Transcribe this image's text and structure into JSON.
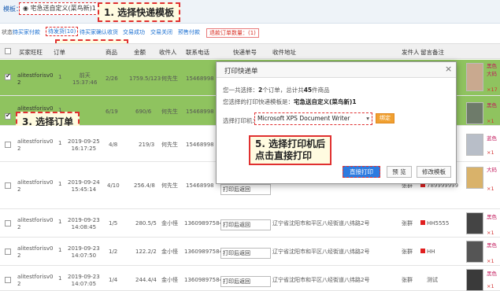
{
  "template_select": {
    "label": "模板：",
    "value": "宅急送自定义(菜鸟新)1"
  },
  "callouts": {
    "c1": "1. 选择快递模板",
    "c2": "2. 点击待发货",
    "c3": "3. 选择订单",
    "c5": "5. 选择打印机后\n点击直接打印"
  },
  "tabs": {
    "label": "状态：",
    "items": [
      "待买家付款",
      "待发货(10)",
      "待买家确认收货",
      "交易成功",
      "交易关闭",
      "预售付款"
    ],
    "refund": "退款订单数量：(1)"
  },
  "table_header": [
    "全选",
    "买家旺旺",
    "订单",
    "商品",
    "金额",
    "收件人",
    "联系电话",
    "快递单号",
    "收件地址",
    "发件人",
    "留言备注"
  ],
  "rows": [
    {
      "buyer": "alitestforisv0\n2",
      "qty": "1",
      "time": "前天\n15:37:46",
      "items": "2/26",
      "amount": "1759.5/123",
      "name": "何先生",
      "phone": "15468998",
      "waybill": "",
      "addr": "",
      "sender": "",
      "note": "",
      "checked": true
    },
    {
      "buyer": "alitestforisv0\n2",
      "qty": "1",
      "time": "",
      "items": "6/19",
      "amount": "690/6",
      "name": "何先生",
      "phone": "15468998",
      "waybill": "",
      "addr": "",
      "sender": "",
      "note": "",
      "checked": true
    },
    {
      "buyer": "alitestforisv0\n2",
      "qty": "1",
      "time": "2019-09-25\n16:17:25",
      "items": "4/8",
      "amount": "219/3",
      "name": "何先生",
      "phone": "15468998",
      "waybill": "",
      "addr": "",
      "sender": "",
      "note": "",
      "checked": false
    },
    {
      "buyer": "alitestforisv0\n2",
      "qty": "1",
      "time": "2019-09-24\n15:45:14",
      "items": "4/10",
      "amount": "256.4/8",
      "name": "何先生",
      "phone": "15468998",
      "waybill": "打印后返回",
      "addr": "",
      "sender": "张群",
      "note": "789999999",
      "checked": false
    },
    {
      "buyer": "alitestforisv0\n2",
      "qty": "1",
      "time": "2019-09-23\n14:08:45",
      "items": "1/5",
      "amount": "280.5/5",
      "name": "金小怪",
      "phone": "13609897584",
      "waybill": "打印后返回",
      "addr": "辽宁省沈阳市和平区八经街道八纬路2号",
      "sender": "张群",
      "note": "HH5555",
      "checked": false
    },
    {
      "buyer": "alitestforisv0\n2",
      "qty": "1",
      "time": "2019-09-23\n14:07:50",
      "items": "1/2",
      "amount": "122.2/2",
      "name": "金小怪",
      "phone": "13609897584",
      "waybill": "打印后返回",
      "addr": "辽宁省沈阳市和平区八经街道八纬路2号",
      "sender": "张群",
      "note": "HH",
      "checked": false
    },
    {
      "buyer": "alitestforisv0\n2",
      "qty": "1",
      "time": "2019-09-23\n14:07:05",
      "items": "1/4",
      "amount": "244.4/4",
      "name": "金小怪",
      "phone": "13609897584",
      "waybill": "打印后返回",
      "addr": "辽宁省沈阳市和平区八经街道八纬路2号",
      "sender": "张群",
      "note": "测试",
      "checked": false
    }
  ],
  "dialog": {
    "title": "打印快递单",
    "line1_pre": "您一共选择：",
    "line1_orders": "2",
    "line1_mid": "个订单，总计共",
    "line1_goods": "45",
    "line1_post": "件商品",
    "line2_pre": "您选择的打印快递模板是：",
    "line2_value": "宅急送自定义(菜鸟新)1",
    "printer_label": "选择打印机：",
    "printer_value": "Microsoft XPS Document Writer",
    "bind_btn": "绑定",
    "print_btn": "直接打印",
    "preview_btn": "预 览",
    "modify_btn": "修改模板"
  },
  "side_labels": [
    "黑色",
    "大码",
    "黑色",
    "蓝色",
    "大码",
    "黑色",
    "黑色",
    "黑色"
  ],
  "side_counts": [
    "×17",
    "×1",
    "×1",
    "×1",
    "×1",
    "×1",
    "×1"
  ],
  "colors": {
    "accent": "#2d7be0",
    "highlight_row": "#8fc35f",
    "callout_border": "#e03030",
    "link": "#1a6fd1"
  }
}
